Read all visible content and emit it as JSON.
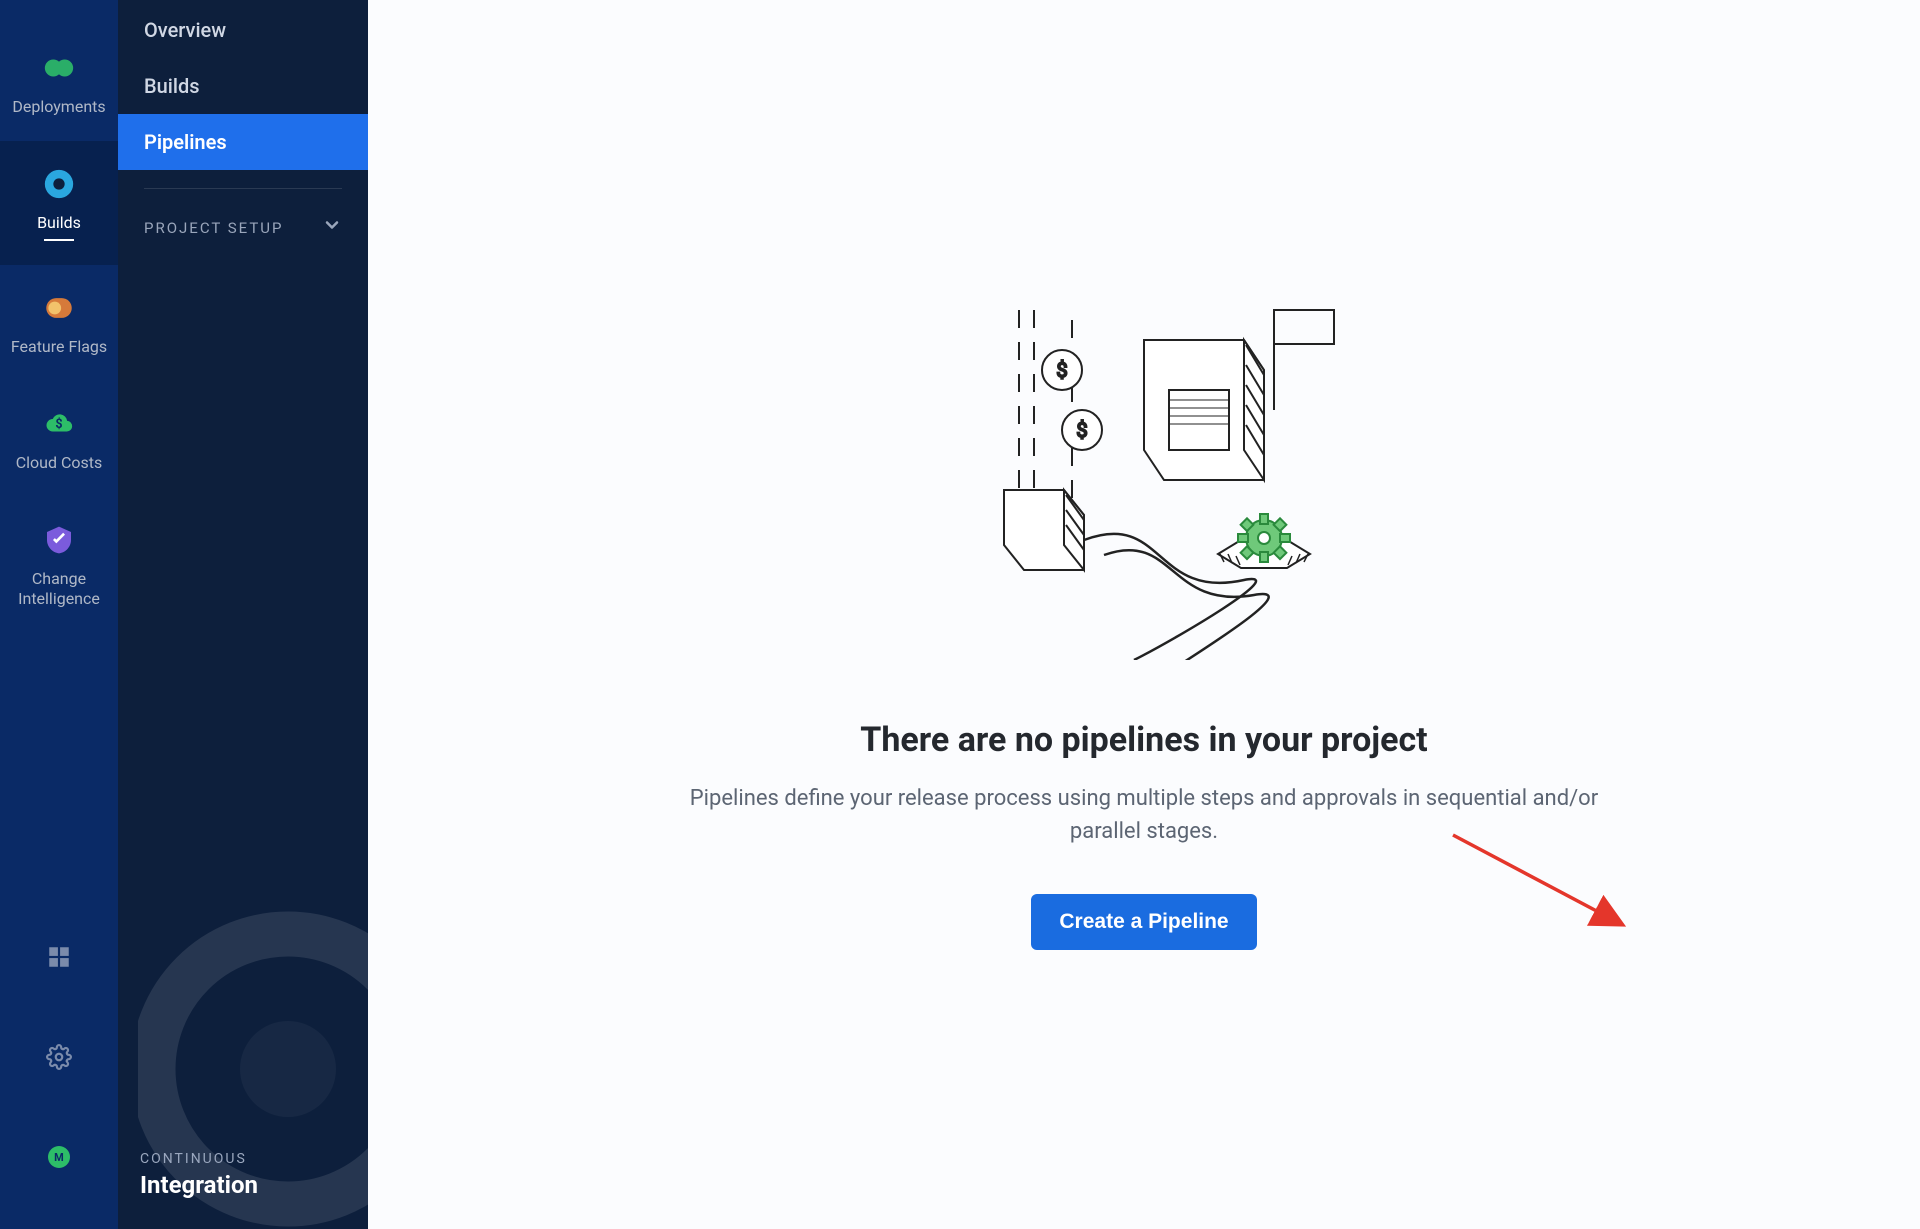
{
  "rail": {
    "items": [
      {
        "id": "deployments",
        "label": "Deployments",
        "icon": "deployments-icon"
      },
      {
        "id": "builds",
        "label": "Builds",
        "icon": "builds-icon",
        "active": true
      },
      {
        "id": "feature-flags",
        "label": "Feature Flags",
        "icon": "feature-flags-icon"
      },
      {
        "id": "cloud-costs",
        "label": "Cloud Costs",
        "icon": "cloud-costs-icon"
      },
      {
        "id": "change-intel",
        "label": "Change\nIntelligence",
        "icon": "change-intel-icon"
      }
    ],
    "bottom": {
      "grid": "dashboard-icon",
      "settings": "settings-icon",
      "user": "user-badge-icon"
    }
  },
  "sidebar": {
    "items": [
      {
        "id": "overview",
        "label": "Overview"
      },
      {
        "id": "builds",
        "label": "Builds"
      },
      {
        "id": "pipelines",
        "label": "Pipelines",
        "active": true
      }
    ],
    "project_setup": "PROJECT SETUP",
    "footer": {
      "small": "CONTINUOUS",
      "big": "Integration"
    }
  },
  "main": {
    "empty_title": "There are no pipelines in your project",
    "empty_desc": "Pipelines define your release process using multiple steps and approvals in sequential and/or parallel stages.",
    "create_button": "Create a Pipeline"
  },
  "colors": {
    "rail_bg": "#0a2a66",
    "sidebar_bg": "#0d1f3c",
    "primary": "#1f6feb",
    "button": "#1a6ce0",
    "accent_green": "#2dbd68"
  }
}
